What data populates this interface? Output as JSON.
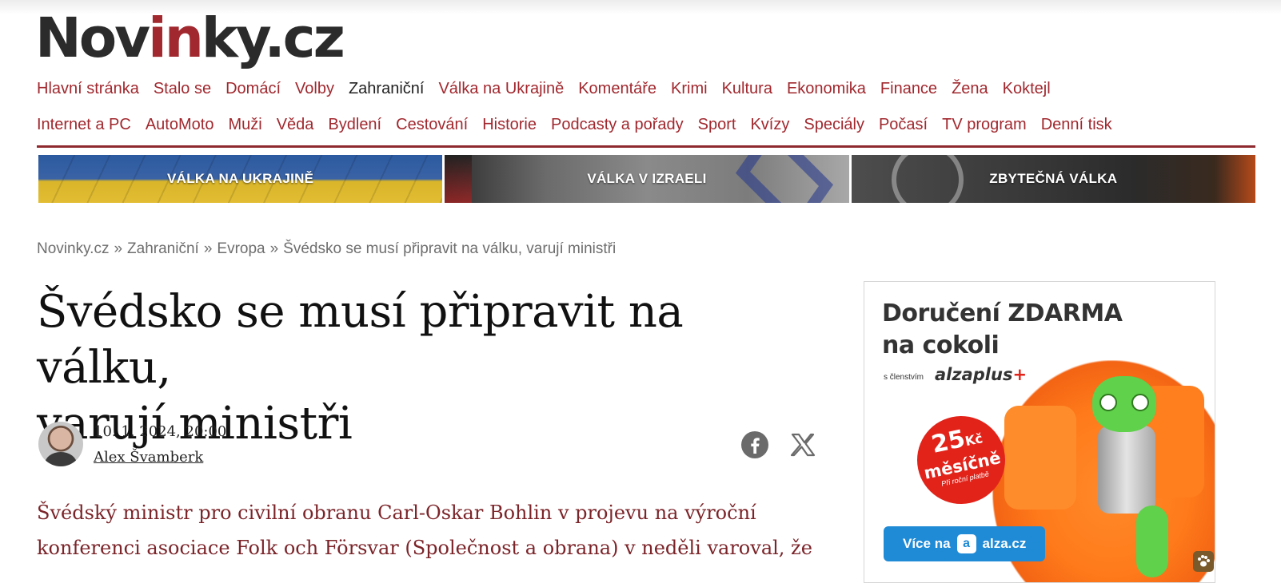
{
  "logo": {
    "before": "Nov",
    "accent": "in",
    "after": "ky.cz"
  },
  "nav_row1": [
    {
      "label": "Hlavní stránka",
      "active": false
    },
    {
      "label": "Stalo se",
      "active": false
    },
    {
      "label": "Domácí",
      "active": false
    },
    {
      "label": "Volby",
      "active": false
    },
    {
      "label": "Zahraniční",
      "active": true
    },
    {
      "label": "Válka na Ukrajině",
      "active": false
    },
    {
      "label": "Komentáře",
      "active": false
    },
    {
      "label": "Krimi",
      "active": false
    },
    {
      "label": "Kultura",
      "active": false
    },
    {
      "label": "Ekonomika",
      "active": false
    },
    {
      "label": "Finance",
      "active": false
    },
    {
      "label": "Žena",
      "active": false
    },
    {
      "label": "Koktejl",
      "active": false
    }
  ],
  "nav_row2": [
    {
      "label": "Internet a PC"
    },
    {
      "label": "AutoMoto"
    },
    {
      "label": "Muži"
    },
    {
      "label": "Věda"
    },
    {
      "label": "Bydlení"
    },
    {
      "label": "Cestování"
    },
    {
      "label": "Historie"
    },
    {
      "label": "Podcasty a pořady"
    },
    {
      "label": "Sport"
    },
    {
      "label": "Kvízy"
    },
    {
      "label": "Speciály"
    },
    {
      "label": "Počasí"
    },
    {
      "label": "TV program"
    },
    {
      "label": "Denní tisk"
    }
  ],
  "banners": {
    "ukraine": "VÁLKA NA UKRAJINĚ",
    "israel": "VÁLKA V IZRAELI",
    "podcast": "ZBYTEČNÁ VÁLKA"
  },
  "breadcrumb": {
    "items": [
      "Novinky.cz",
      "Zahraniční",
      "Evropa",
      "Švédsko se musí připravit na válku, varují ministři"
    ],
    "separator": "»"
  },
  "article": {
    "title_line1": "Švédsko se musí připravit na válku,",
    "title_line2": "varují ministři",
    "date": "10. 1. 2024, 20:00",
    "author": "Alex Švamberk",
    "lead_line1": "Švédský ministr pro civilní obranu Carl-Oskar Bohlin v projevu na výroční",
    "lead_line2": "konferenci asociace Folk och Försvar (Společnost a obrana) v neděli varoval, že"
  },
  "share": {
    "facebook_icon": "facebook-icon",
    "x_icon": "x-icon"
  },
  "ad": {
    "headline_line1": "Doručení ZDARMA",
    "headline_line2": "na cokoli",
    "subline": "s členstvím",
    "brand": "alza",
    "brand_plus": "plus",
    "brand_plus_sign": "+",
    "badge_number": "25",
    "badge_currency": "Kč",
    "badge_period": "měsíčně",
    "badge_note": "Při roční platbě",
    "button_label": "Více na",
    "button_brand": "alza.cz",
    "colors": {
      "red": "#e2231a",
      "blue": "#1f8ad6",
      "orange": "#ff7a1a",
      "green": "#5fd14b"
    }
  },
  "colors": {
    "brand_red": "#a1282e",
    "nav_rule": "#8e2a2f",
    "lead_text": "#7b2429"
  }
}
